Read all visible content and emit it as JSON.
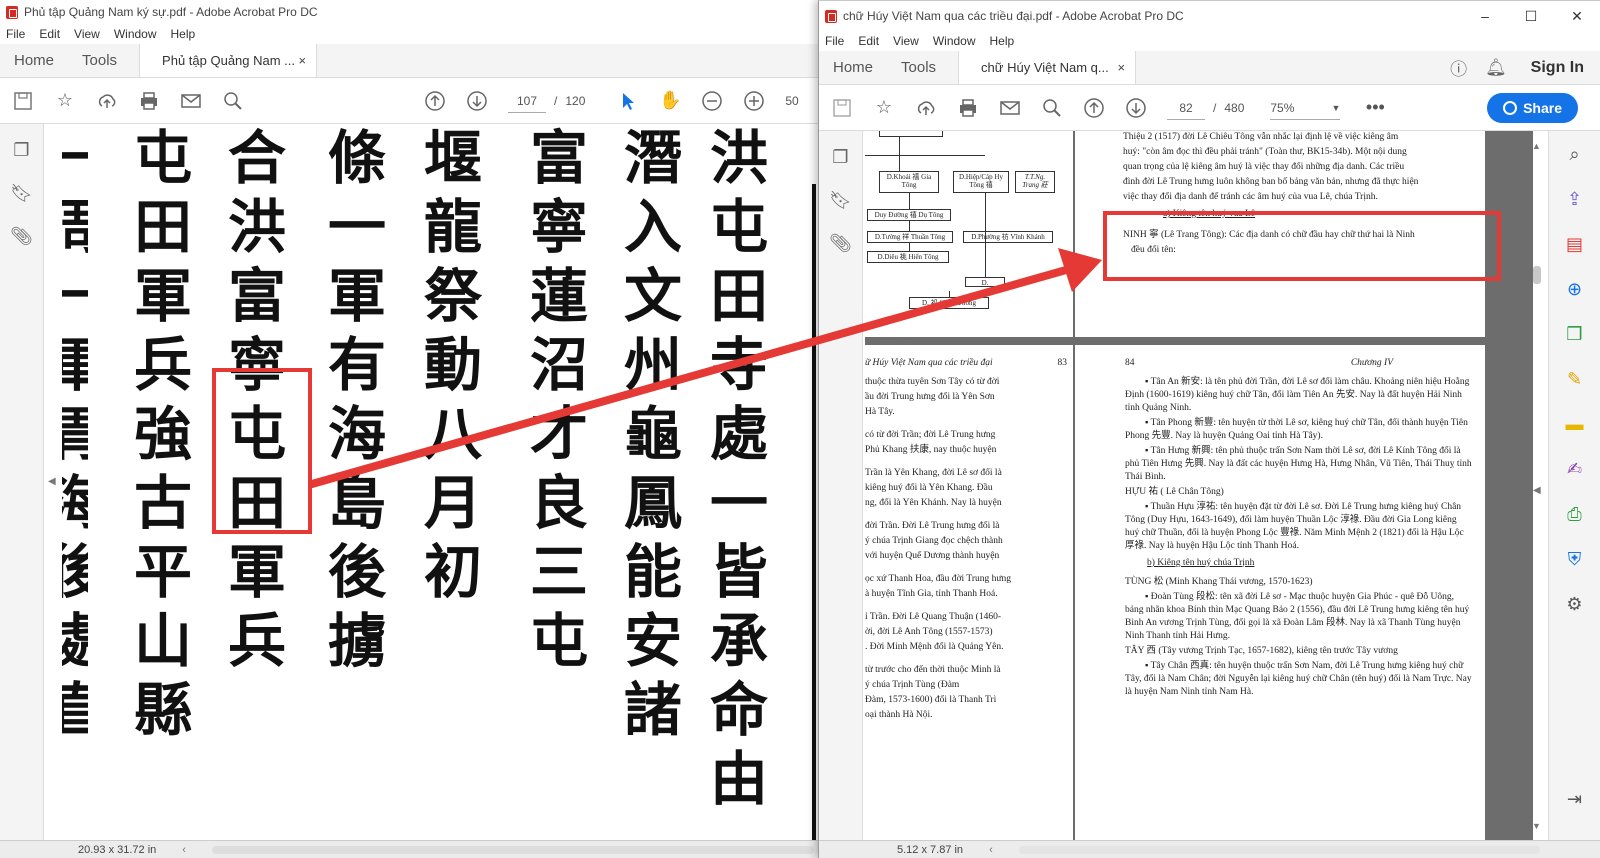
{
  "left_window": {
    "title": "Phủ tập Quảng Nam ký sự.pdf - Adobe Acrobat Pro DC",
    "menu": [
      "File",
      "Edit",
      "View",
      "Window",
      "Help"
    ],
    "tabs": {
      "home": "Home",
      "tools": "Tools",
      "doc_tab": "Phủ tập Quảng Nam ...",
      "close": "×"
    },
    "toolbar": {
      "page_current": "107",
      "page_sep": "/",
      "page_total": "120",
      "zoom_partial": "50"
    },
    "status": {
      "dimensions": "20.93 x 31.72 in"
    },
    "document_columns": [
      "洪屯田寺處一皆承命由",
      "潛入文州龜鳳能安諸",
      "富寧蓮沼才良三屯",
      "堰龍祭動八月初",
      "條一軍有海島後擄",
      "合洪富寧屯田軍兵",
      "屯田軍兵強古平山縣",
      "一周一軍胃海後處直"
    ],
    "highlight_text": "富寧"
  },
  "right_window": {
    "title": "chữ Húy Việt Nam qua các triều đại.pdf - Adobe Acrobat Pro DC",
    "menu": [
      "File",
      "Edit",
      "View",
      "Window",
      "Help"
    ],
    "tabs": {
      "home": "Home",
      "tools": "Tools",
      "doc_tab": "chữ Húy Việt Nam q...",
      "close": "×"
    },
    "sign_in": "Sign In",
    "share_label": "Share",
    "toolbar": {
      "page_current": "82",
      "page_sep": "/",
      "page_total": "480",
      "zoom": "75%"
    },
    "status": {
      "dimensions": "5.12 x 7.87 in"
    },
    "page82": {
      "flow_boxes": [
        "D.Khoái 禧 Gia Tông",
        "D.Hiệp/Cáp Hy Tông 禧",
        "T.T.Ng. Trang 莊",
        "Duy Đường 禧 Dụ Tông",
        "D.Tường 祥 Thuần Tông",
        "D.Phường 祊 Vĩnh Khánh",
        "D.Diêu 祧 Hiển Tông",
        "D.",
        "D. 祁 Chiêu Thống"
      ],
      "text_lines": [
        "Thiệu 2 (1517) đời Lê Chiêu Tông vẫn nhắc lại định lệ về việc kiêng âm",
        "huý: \"còn âm đọc thì đều phải tránh\" (Toàn thư, BK15-34b). Một nội dung",
        "quan trọng của lệ kiêng âm huý là việc thay đổi những địa danh. Các triều",
        "đình đời Lê Trung hưng luôn không ban bố bảng văn bản, nhưng đã thực hiện",
        "việc thay đổi địa danh để tránh các âm huý của vua Lê, chúa Trịnh."
      ],
      "subheading": "a)   Kiêng tên huý vua Lê",
      "highlight_line1": "NINH 寧 (Lê Trang Tông): Các địa danh có chữ đầu hay chữ thứ hai là Ninh",
      "highlight_line2": "đều đổi tên:"
    },
    "page83": {
      "header_title": "ữ Húy Việt Nam qua các triều đại",
      "page_no": "83",
      "paragraphs": [
        "thuộc thừa tuyên Sơn Tây có từ đời",
        "ầu đời Trung hưng đổi là Yên Sơn",
        "Hà Tây.",
        "có từ đời Trần; đời Lê Trung hưng",
        "Phủ Khang 扶康, nay thuộc huyện",
        "Trần là Yên Khang, đời Lê sơ đổi là",
        "kiêng huý đổi là Yên Khang. Đầu",
        "ng, đổi là Yên Khánh. Nay là huyện",
        "đời Trần. Đời Lê Trung hưng đổi là",
        "ý chúa Trịnh Giang đọc chệch thành",
        "với huyện Quế Dương thành huyện",
        "ọc xứ Thanh Hoa, đầu đời Trung hưng",
        "à huyện Tĩnh Gia, tỉnh Thanh Hoá.",
        "ỉ Trần. Đời Lê Quang Thuận (1460-",
        "ời, đời Lê Anh Tông (1557-1573)",
        ". Đời Minh Mệnh đổi là Quảng Yên.",
        "từ trước cho đến thời thuộc Minh là",
        "ý chúa Trịnh Tùng (Đàm",
        "Đàm, 1573-1600) đổi là Thanh Trì",
        "oại thành Hà Nội."
      ]
    },
    "page84": {
      "page_no": "84",
      "header_title": "Chương IV",
      "paragraphs": [
        "▪ Tân An 新安: là tên phủ đời Trần, đời Lê sơ đổi làm châu. Khoảng niên hiệu Hoằng Định (1600-1619) kiêng huý chữ Tân, đổi làm Tiên An 先安. Nay là đất huyện Hải Ninh tỉnh Quảng Ninh.",
        "▪ Tân Phong 新豐: tên huyện từ thời Lê sơ, kiêng huý chữ Tân, đổi thành huyện Tiên Phong 先豐. Nay là huyện Quảng Oai tỉnh Hà Tây).",
        "▪ Tân Hưng 新興: tên phủ thuộc trấn Sơn Nam thời Lê sơ, đời Lê Kính Tông đổi là phủ Tiên Hưng 先興. Nay là đất các huyện Hưng Hà, Hưng Nhân, Vũ Tiên, Thái Thuỵ tỉnh Thái Bình.",
        "HỰU 祐 ( Lê Chân Tông)",
        "▪ Thuần Hựu 淳祐: tên huyện đặt từ đời Lê sơ. Đời Lê Trung hưng kiêng huý Chân Tông (Duy Hựu, 1643-1649), đổi làm huyện Thuần Lộc 淳祿. Đầu đời Gia Long kiêng huý chữ Thuần, đổi là huyện Phong Lộc 豐祿. Năm Minh Mệnh 2 (1821) đổi là Hậu Lộc 厚祿. Nay là huyện Hậu Lộc tỉnh Thanh Hoá.",
        "b)   Kiêng tên huý chúa Trịnh",
        "TÙNG 松 (Minh Khang Thái vương, 1570-1623)",
        "▪ Đoàn Tùng 段松: tên xã đời Lê sơ - Mạc thuộc huyện Gia Phúc - quê Đỗ Uông, bảng nhãn khoa Bính thìn Mạc Quang Bảo 2 (1556), đầu đời Lê Trung hưng kiêng tên huý Bình An vương Trịnh Tùng, đổi gọi là xã Đoàn Lâm 段林. Nay là xã Thanh Tùng huyện Ninh Thanh tỉnh Hải Hưng.",
        "TÂY 西 (Tây vương Trịnh Tạc, 1657-1682), kiêng tên trước Tây vương",
        "▪ Tây Chân 西真: tên huyện thuộc trấn Sơn Nam, đời Lê Trung hưng kiêng huý chữ Tây, đổi là Nam Chân; đời Nguyễn lại kiêng huý chữ Chân (tên huý) đổi là Nam Trực. Nay là huyện Nam Ninh tỉnh Nam Hà."
      ]
    }
  },
  "colors": {
    "highlight_red": "#e53935",
    "acrobat_blue": "#1473e6",
    "pdf_red": "#d42a1f"
  }
}
